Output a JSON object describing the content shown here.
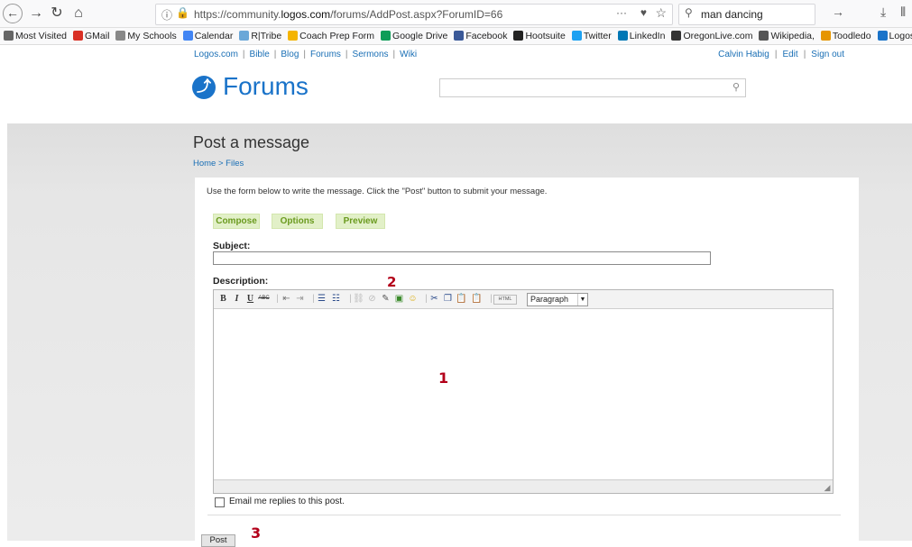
{
  "browser": {
    "url_prefix": "https://community.",
    "url_domain": "logos.com",
    "url_path": "/forums/AddPost.aspx?ForumID=66",
    "search_text": "man dancing",
    "bookmarks": [
      {
        "label": "Most Visited",
        "color": "#666666"
      },
      {
        "label": "GMail",
        "color": "#d93025"
      },
      {
        "label": "My Schools",
        "color": "#888888"
      },
      {
        "label": "Calendar",
        "color": "#4285f4"
      },
      {
        "label": "R|Tribe",
        "color": "#6aa7d8"
      },
      {
        "label": "Coach Prep Form",
        "color": "#f4b400"
      },
      {
        "label": "Google Drive",
        "color": "#0f9d58"
      },
      {
        "label": "Facebook",
        "color": "#3b5998"
      },
      {
        "label": "Hootsuite",
        "color": "#222222"
      },
      {
        "label": "Twitter",
        "color": "#1da1f2"
      },
      {
        "label": "LinkedIn",
        "color": "#0077b5"
      },
      {
        "label": "OregonLive.com",
        "color": "#333333"
      },
      {
        "label": "Wikipedia,",
        "color": "#555555"
      },
      {
        "label": "Toodledo",
        "color": "#e69500"
      },
      {
        "label": "Logos Forun",
        "color": "#1a73c9"
      }
    ]
  },
  "site": {
    "top_nav": [
      "Logos.com",
      "Bible",
      "Blog",
      "Forums",
      "Sermons",
      "Wiki"
    ],
    "user_name": "Calvin Habig",
    "user_links": [
      "Edit",
      "Sign out"
    ],
    "logo_text": "Forums",
    "logo_symbol": "⤴"
  },
  "page": {
    "title": "Post a message",
    "breadcrumb": "Home > Files",
    "instructions": "Use the form below to write the message. Click the \"Post\" button to submit your message.",
    "tabs": [
      "Compose",
      "Options",
      "Preview"
    ],
    "subject_label": "Subject:",
    "subject_value": "",
    "description_label": "Description:",
    "format_value": "Paragraph",
    "email_label": "Email me replies to this post.",
    "post_label": "Post"
  },
  "annotations": {
    "editor": "1",
    "toolbar": "2",
    "post": "3"
  }
}
